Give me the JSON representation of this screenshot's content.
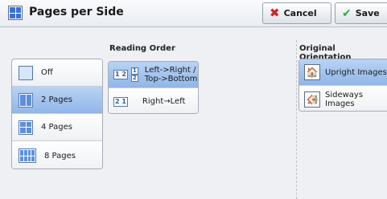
{
  "window": {
    "title": "Pages per Side"
  },
  "toolbar": {
    "cancel_label": "Cancel",
    "save_label": "Save"
  },
  "pages_per_side": {
    "items": [
      {
        "label": "Off",
        "selected": false
      },
      {
        "label": "2 Pages",
        "selected": true
      },
      {
        "label": "4 Pages",
        "selected": false
      },
      {
        "label": "8 Pages",
        "selected": false
      }
    ]
  },
  "reading_order": {
    "title": "Reading Order",
    "items": [
      {
        "label": "Left->Right /\nTop->Bottom",
        "selected": true
      },
      {
        "label": "Right→Left",
        "selected": false
      }
    ]
  },
  "original_orientation": {
    "title": "Original Orientation",
    "items": [
      {
        "label": "Upright Images",
        "selected": true
      },
      {
        "label": "Sideways\nImages",
        "selected": false
      }
    ]
  }
}
